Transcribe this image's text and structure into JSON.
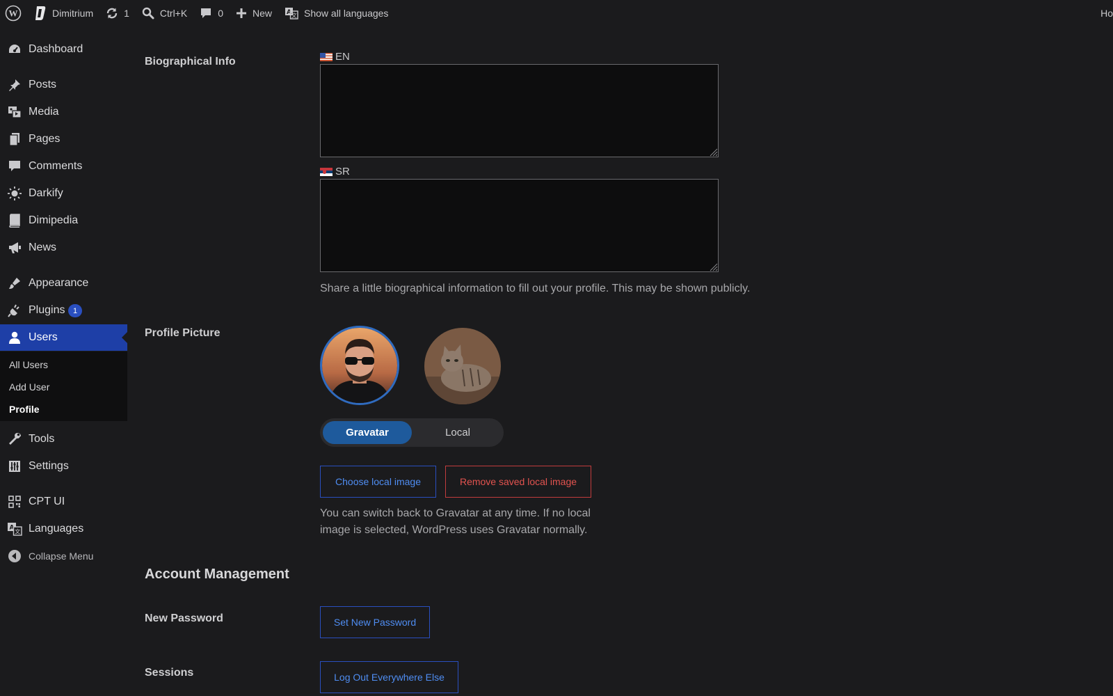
{
  "adminbar": {
    "site_name": "Dimitrium",
    "updates_count": "1",
    "search_shortcut": "Ctrl+K",
    "comments_count": "0",
    "new_label": "New",
    "languages_label": "Show all languages",
    "right_partial": "Ho"
  },
  "sidebar": {
    "items": {
      "dashboard": "Dashboard",
      "posts": "Posts",
      "media": "Media",
      "pages": "Pages",
      "comments": "Comments",
      "darkify": "Darkify",
      "dimipedia": "Dimipedia",
      "news": "News",
      "appearance": "Appearance",
      "plugins": "Plugins",
      "plugins_badge": "1",
      "users": "Users",
      "tools": "Tools",
      "settings": "Settings",
      "cpt_ui": "CPT UI",
      "languages": "Languages",
      "collapse": "Collapse Menu"
    },
    "users_submenu": {
      "all_users": "All Users",
      "add_user": "Add User",
      "profile": "Profile"
    }
  },
  "profile": {
    "bio_label": "Biographical Info",
    "lang_en": "EN",
    "lang_sr": "SR",
    "bio_en_value": "",
    "bio_sr_value": "",
    "bio_description": "Share a little biographical information to fill out your profile. This may be shown publicly.",
    "picture_label": "Profile Picture",
    "toggle_gravatar": "Gravatar",
    "toggle_local": "Local",
    "choose_local": "Choose local image",
    "remove_local": "Remove saved local image",
    "picture_note_line1": "You can switch back to Gravatar at any time. If no local",
    "picture_note_line2": "image is selected, WordPress uses Gravatar normally.",
    "account_title": "Account Management",
    "new_password_label": "New Password",
    "set_password": "Set New Password",
    "sessions_label": "Sessions",
    "logout_else": "Log Out Everywhere Else"
  },
  "colors": {
    "accent": "#1e3fa7",
    "link": "#4f8df2",
    "danger": "#e2534f",
    "background": "#1b1b1d"
  }
}
